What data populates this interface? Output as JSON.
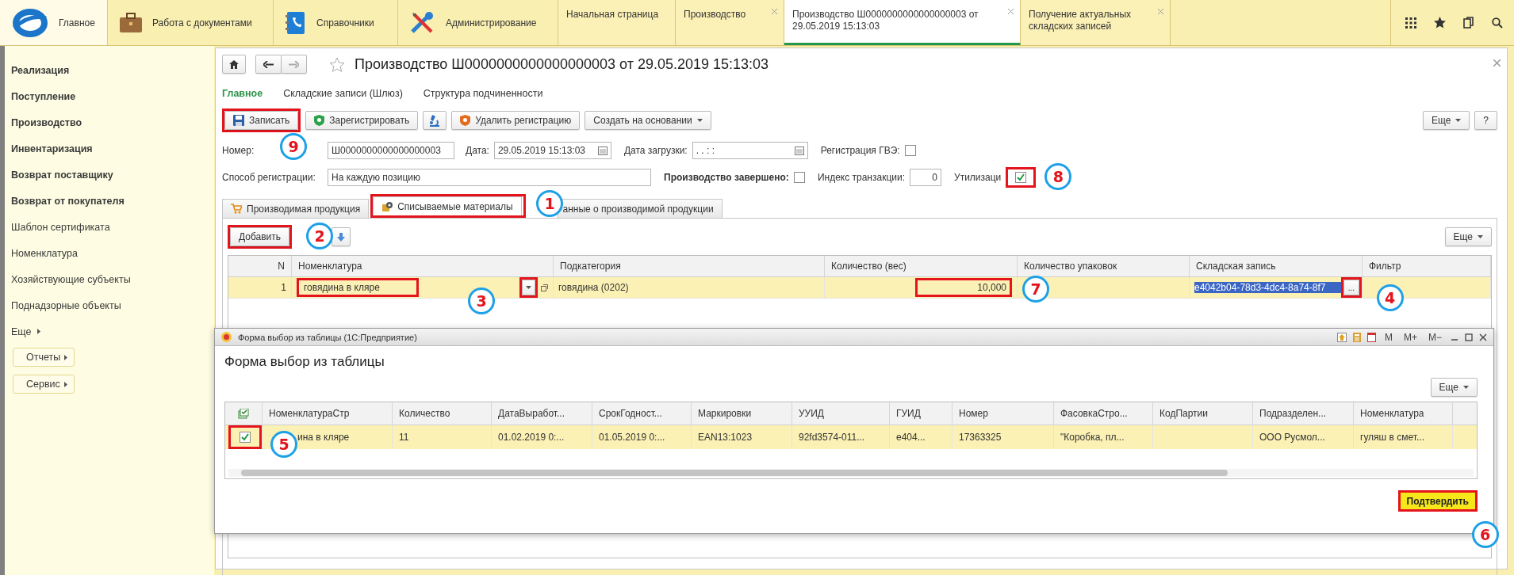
{
  "top_bar": {
    "sections": [
      {
        "label": "Главное",
        "selected": true
      },
      {
        "label": "Работа с документами",
        "selected": false
      },
      {
        "label": "Справочники",
        "selected": false
      },
      {
        "label": "Администрирование",
        "selected": false
      }
    ],
    "tabs": [
      {
        "label": "Начальная страница",
        "selected": false,
        "closable": false
      },
      {
        "label": "Производство",
        "selected": false,
        "closable": true
      },
      {
        "label": "Производство Ш0000000000000000003 от 29.05.2019 15:13:03",
        "selected": true,
        "closable": true
      },
      {
        "label": "Получение актуальных складских записей",
        "selected": false,
        "closable": true
      }
    ]
  },
  "sidebar": {
    "items": [
      {
        "label": "Реализация",
        "bold": true
      },
      {
        "label": "Поступление",
        "bold": true
      },
      {
        "label": "Производство",
        "bold": true
      },
      {
        "label": "Инвентаризация",
        "bold": true
      },
      {
        "label": "Возврат поставщику",
        "bold": true
      },
      {
        "label": "Возврат от покупателя",
        "bold": true
      },
      {
        "label": "Шаблон сертификата",
        "bold": false
      },
      {
        "label": "Номенклатура",
        "bold": false
      },
      {
        "label": "Хозяйствующие субъекты",
        "bold": false
      },
      {
        "label": "Поднадзорные объекты",
        "bold": false
      }
    ],
    "more": "Еще",
    "buttons": [
      "Отчеты",
      "Сервис"
    ]
  },
  "form": {
    "title": "Производство Ш0000000000000000003 от 29.05.2019 15:13:03",
    "nav": [
      {
        "label": "Главное",
        "selected": true
      },
      {
        "label": "Складские записи (Шлюз)",
        "selected": false
      },
      {
        "label": "Структура подчиненности",
        "selected": false
      }
    ],
    "toolbar": [
      {
        "kind": "text",
        "label": "Записать",
        "highlighted": true,
        "step": "9"
      },
      {
        "kind": "text",
        "label": "Зарегистрировать",
        "highlighted": false
      },
      {
        "kind": "icon",
        "highlighted": false
      },
      {
        "kind": "text",
        "label": "Удалить регистрацию",
        "highlighted": false
      },
      {
        "kind": "menu",
        "label": "Создать на основании",
        "highlighted": false
      }
    ],
    "toolbar_right": [
      {
        "kind": "menu",
        "label": "Еще"
      },
      {
        "kind": "text",
        "label": "?"
      }
    ],
    "field_rows": [
      [
        {
          "kind": "text",
          "label": "Номер:",
          "value": "Ш0000000000000000003",
          "bold": false,
          "highlighted": false
        },
        {
          "kind": "date",
          "label": "Дата:",
          "value": "29.05.2019 15:13:03",
          "bold": false,
          "highlighted": false
        },
        {
          "kind": "date",
          "label": "Дата загрузки:",
          "value": " .  .        :  :",
          "bold": false,
          "highlighted": false
        },
        {
          "kind": "check",
          "label": "Регистрация ГВЭ:",
          "checked": false,
          "bold": false,
          "highlighted": false
        }
      ],
      [
        {
          "kind": "text",
          "label": "Способ регистрации:",
          "value": "На каждую позицию",
          "bold": false,
          "highlighted": false
        },
        {
          "kind": "check",
          "label": "Производство завершено:",
          "checked": false,
          "bold": true,
          "highlighted": false
        },
        {
          "kind": "number",
          "label": "Индекс транзакции:",
          "value": "0",
          "bold": false,
          "highlighted": false
        },
        {
          "kind": "check",
          "label": "Утилизаци",
          "checked": true,
          "bold": false,
          "highlighted": true,
          "step": "8"
        }
      ]
    ],
    "tabs": [
      {
        "label": "Производимая продукция",
        "selected": false,
        "highlighted": false
      },
      {
        "label": "Списываемые материалы",
        "selected": true,
        "highlighted": true,
        "step": "1"
      },
      {
        "label": "анные о производимой продукции",
        "selected": false,
        "highlighted": false
      }
    ],
    "table_toolbar": [
      {
        "kind": "text",
        "label": "Добавить",
        "highlighted": true,
        "step": "2"
      },
      {
        "kind": "icon",
        "highlighted": false
      }
    ],
    "table_more": "Еще",
    "columns": [
      "N",
      "Номенклатура",
      "Подкатегория",
      "Количество (вес)",
      "Количество упаковок",
      "Складская запись",
      "Фильтр"
    ],
    "rows": [
      {
        "selected": true,
        "n": "1",
        "nomenclature": "говядина в кляре",
        "nomenclature_highlighted": true,
        "dropdown_highlighted": true,
        "dropdown_step": "3",
        "subcategory": "говядина (0202)",
        "quantity": "10,000",
        "quantity_highlighted": true,
        "quantity_step": "7",
        "warehouse_record": "e4042b04-78d3-4dc4-8a74-8f7",
        "record_text_selected": true,
        "picker_label": "...",
        "picker_highlighted": true,
        "picker_step": "4"
      }
    ]
  },
  "dialog": {
    "window_title": "Форма выбор из таблицы (1С:Предприятие)",
    "title_buttons": [
      "M",
      "M+",
      "M−"
    ],
    "heading": "Форма выбор из таблицы",
    "more": "Еще",
    "columns": [
      "НоменклатураСтр",
      "Количество",
      "ДатаВыработ...",
      "СрокГодност...",
      "Маркировки",
      "УУИД",
      "ГУИД",
      "Номер",
      "ФасовкаСтро...",
      "КодПартии",
      "Подразделен...",
      "Номенклатура"
    ],
    "rows": [
      {
        "selected": true,
        "checked": true,
        "check_highlighted": true,
        "step": "5",
        "nomenclature_str": "ина в кляре",
        "quantity": "11",
        "production_date": "01.02.2019 0:...",
        "expiry_date": "01.05.2019 0:...",
        "markings": "EAN13:1023",
        "uuid": "92fd3574-011...",
        "guid": "e404...",
        "number": "17363325",
        "packaging": "\"Коробка, пл...",
        "department": "ООО Русмол...",
        "nomenclature": "гуляш в смет..."
      }
    ],
    "confirm": {
      "label": "Подтвердить",
      "highlighted": true,
      "step": "6"
    }
  }
}
